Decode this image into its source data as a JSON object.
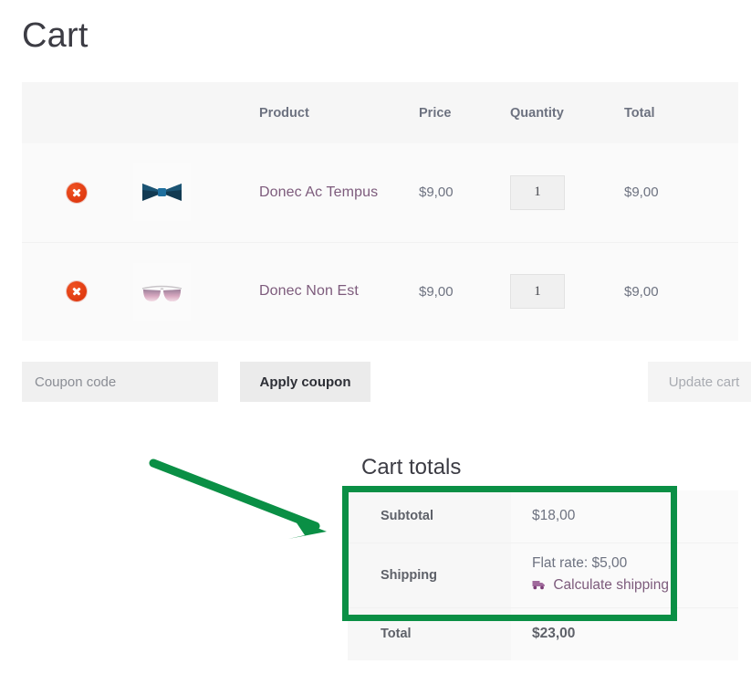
{
  "page": {
    "title": "Cart"
  },
  "cart_table": {
    "headers": {
      "remove": "",
      "thumbnail": "",
      "product": "Product",
      "price": "Price",
      "quantity": "Quantity",
      "total": "Total"
    },
    "rows": [
      {
        "remove_icon": "remove-circle-x-icon",
        "thumbnail_icon": "bow-tie-product-image",
        "name": "Donec Ac Tempus",
        "price": "$9,00",
        "quantity": "1",
        "total": "$9,00"
      },
      {
        "remove_icon": "remove-circle-x-icon",
        "thumbnail_icon": "sunglasses-product-image",
        "name": "Donec Non Est",
        "price": "$9,00",
        "quantity": "1",
        "total": "$9,00"
      }
    ]
  },
  "coupon": {
    "placeholder": "Coupon code",
    "value": "",
    "apply_label": "Apply coupon",
    "update_cart_label": "Update cart"
  },
  "cart_totals": {
    "heading": "Cart totals",
    "subtotal_label": "Subtotal",
    "subtotal_value": "$18,00",
    "shipping_label": "Shipping",
    "shipping_rate": "Flat rate: $5,00",
    "calculate_shipping_label": "Calculate shipping",
    "calculate_shipping_icon": "delivery-truck-icon",
    "total_label": "Total",
    "total_value": "$23,00"
  },
  "annotations": {
    "highlight_color": "#0a8f45",
    "arrow_color": "#0a8f45",
    "highlight_target": "shipping-and-subtotal-rows",
    "arrow_direction": "down-right"
  },
  "colors": {
    "link": "#7d5b7c",
    "remove_button": "#e03a10",
    "header_text": "#6d7280",
    "table_header_bg": "#f6f6f6",
    "row_bg": "#fafafa",
    "annotation_green": "#0a8f45"
  }
}
